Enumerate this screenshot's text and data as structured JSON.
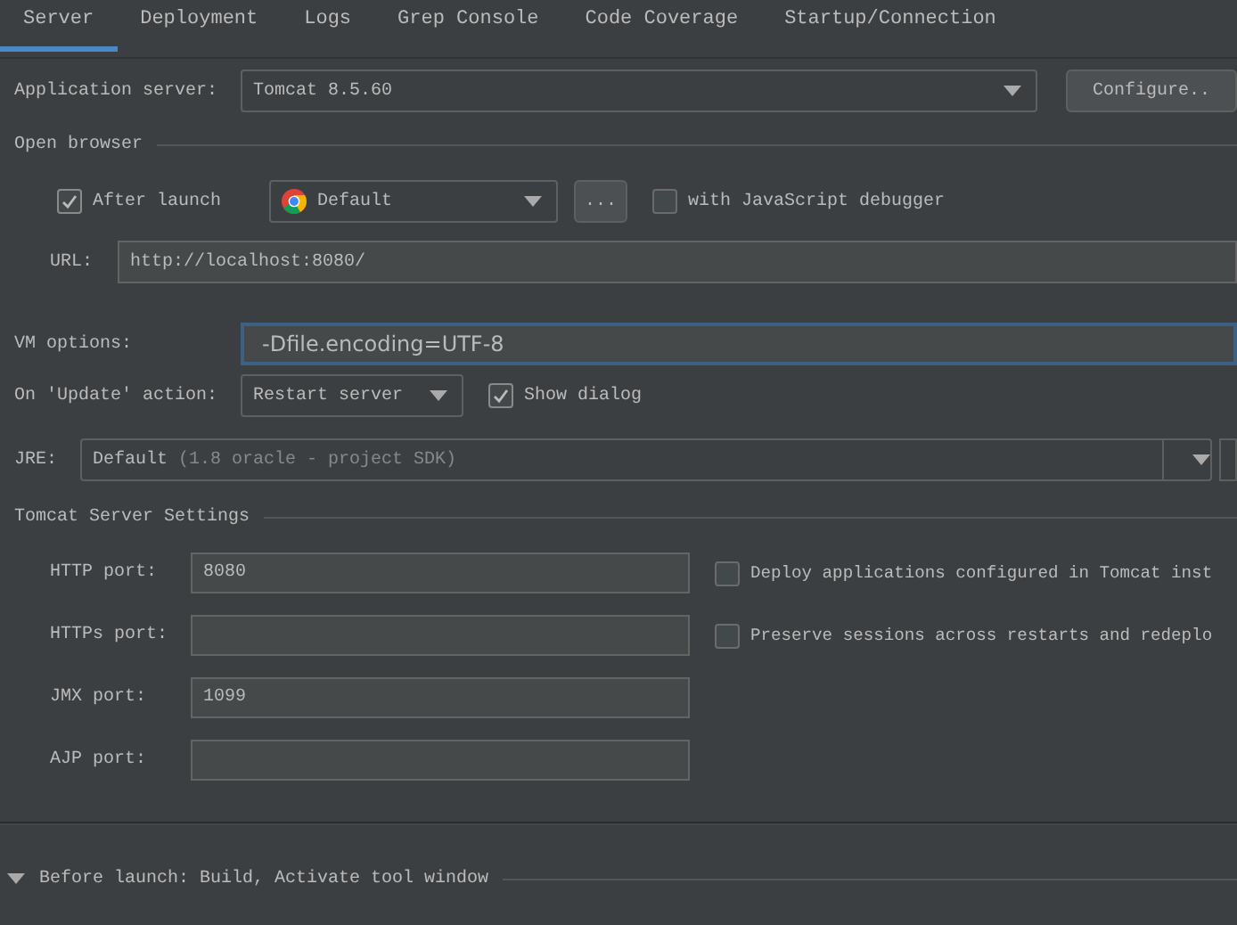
{
  "tabs": [
    {
      "label": "Server",
      "selected": true
    },
    {
      "label": "Deployment",
      "selected": false
    },
    {
      "label": "Logs",
      "selected": false
    },
    {
      "label": "Grep Console",
      "selected": false
    },
    {
      "label": "Code Coverage",
      "selected": false
    },
    {
      "label": "Startup/Connection",
      "selected": false
    }
  ],
  "application_server": {
    "label": "Application server:",
    "value": "Tomcat 8.5.60",
    "button": "Configure.."
  },
  "open_browser": {
    "title": "Open browser",
    "after_launch": {
      "label": "After launch",
      "checked": true
    },
    "browser": "Default",
    "more_button": "...",
    "js_debugger": {
      "label": "with JavaScript debugger",
      "checked": false
    },
    "url_label": "URL:",
    "url": "http://localhost:8080/"
  },
  "vm_options": {
    "label": "VM options:",
    "value": "-Dfile.encoding=UTF-8",
    "focused": true
  },
  "update_action": {
    "label": "On 'Update' action:",
    "value": "Restart server",
    "show_dialog": {
      "label": "Show dialog",
      "checked": true
    }
  },
  "jre": {
    "label": "JRE:",
    "value": "Default",
    "detail": "(1.8 oracle - project SDK)"
  },
  "tomcat_settings": {
    "title": "Tomcat Server Settings",
    "ports": [
      {
        "label": "HTTP port:",
        "value": "8080"
      },
      {
        "label": "HTTPs port:"
      },
      {
        "label": "JMX port:",
        "value": "1099"
      },
      {
        "label": "AJP port:"
      }
    ],
    "options": [
      {
        "label": "Deploy applications configured in Tomcat inst",
        "checked": false
      },
      {
        "label": "Preserve sessions across restarts and redeplo",
        "checked": false
      }
    ]
  },
  "before_launch": {
    "label": "Before launch: Build, Activate tool window",
    "expanded": true
  }
}
